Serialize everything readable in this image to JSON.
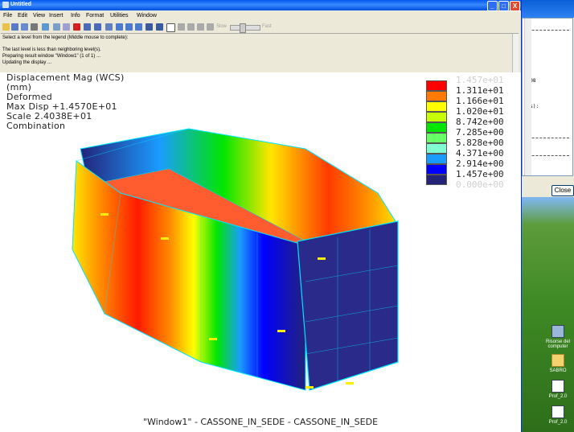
{
  "window": {
    "title": "Untitled",
    "controls": [
      "_",
      "□",
      "X"
    ]
  },
  "menu": [
    "File",
    "Edit",
    "View",
    "Insert",
    "Info",
    "Format",
    "Utilities",
    "Window"
  ],
  "toolbar": {
    "slow_label": "Slow",
    "fast_label": "Fast"
  },
  "messages": [
    "Select a level from the legend (Middle mouse to complete):",
    "",
    "The last level is less than neighboring level(s).",
    "Preparing result window \"Window1\" (1 of 1) ...",
    "Updating the display ..."
  ],
  "result_info": {
    "quantity": "Displacement Mag (WCS)",
    "units": "(mm)",
    "mode": "Deformed",
    "max_disp": "Max Disp    +1.4570E+01",
    "scale": "Scale     2.4038E+01",
    "load": "Combination"
  },
  "legend": {
    "levels": [
      {
        "label": "1.457e+01",
        "color": "#ffffff"
      },
      {
        "label": "1.311e+01",
        "color": "#ff0000"
      },
      {
        "label": "1.166e+01",
        "color": "#ff7a00"
      },
      {
        "label": "1.020e+01",
        "color": "#ffff00"
      },
      {
        "label": "8.742e+00",
        "color": "#c8ff00"
      },
      {
        "label": "7.285e+00",
        "color": "#00e600"
      },
      {
        "label": "5.828e+00",
        "color": "#66ff66"
      },
      {
        "label": "4.371e+00",
        "color": "#80ffd0"
      },
      {
        "label": "2.914e+00",
        "color": "#1a9cff"
      },
      {
        "label": "1.457e+00",
        "color": "#0000ff"
      },
      {
        "label": "0.000e+00",
        "color": "#23237a"
      }
    ],
    "faded_first": "1.457e+01",
    "faded_last": "0.000e+00"
  },
  "footer": "\"Window1\" - CASSONE_IN_SEDE - CASSONE_IN_SEDE",
  "background_window": {
    "lines": [
      "0",
      "3008",
      "tes):",
      "0"
    ],
    "close_label": "Close"
  },
  "desktop_icons": [
    {
      "label": "Risorse del computer",
      "icon": "computer-icon"
    },
    {
      "label": "SABRO",
      "icon": "folder-icon"
    },
    {
      "label": "Prof_2.0",
      "icon": "document-icon"
    },
    {
      "label": "Prof_2.0",
      "icon": "document-icon"
    }
  ]
}
